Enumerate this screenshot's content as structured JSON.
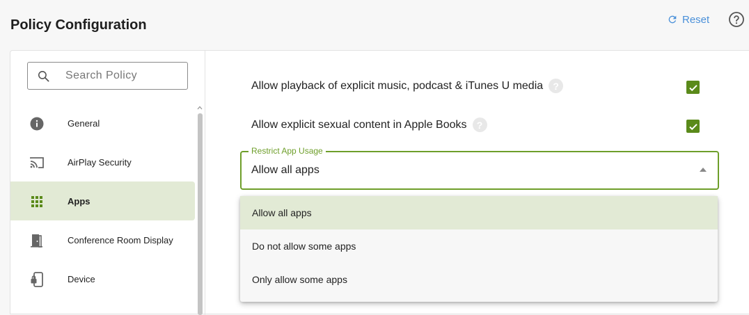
{
  "header": {
    "title": "Policy Configuration",
    "reset_label": "Reset"
  },
  "sidebar": {
    "search_placeholder": "Search Policy",
    "items": [
      {
        "label": "General",
        "icon": "info-icon"
      },
      {
        "label": "AirPlay Security",
        "icon": "airplay-icon"
      },
      {
        "label": "Apps",
        "icon": "apps-grid-icon",
        "active": true
      },
      {
        "label": "Conference Room Display",
        "icon": "door-icon"
      },
      {
        "label": "Device",
        "icon": "device-lock-icon"
      }
    ]
  },
  "settings": [
    {
      "label": "Allow playback of explicit music, podcast & iTunes U media",
      "checked": true
    },
    {
      "label": "Allow explicit sexual content in Apple Books",
      "checked": true
    }
  ],
  "restrict_app_usage": {
    "legend": "Restrict App Usage",
    "value": "Allow all apps",
    "options": [
      "Allow all apps",
      "Do not allow some apps",
      "Only allow some apps"
    ],
    "selected_index": 0
  },
  "colors": {
    "accent_green": "#6e9e2a",
    "active_bg": "#e2ead5",
    "checkbox_green": "#5a8a1a",
    "link_blue": "#4a90d9"
  }
}
